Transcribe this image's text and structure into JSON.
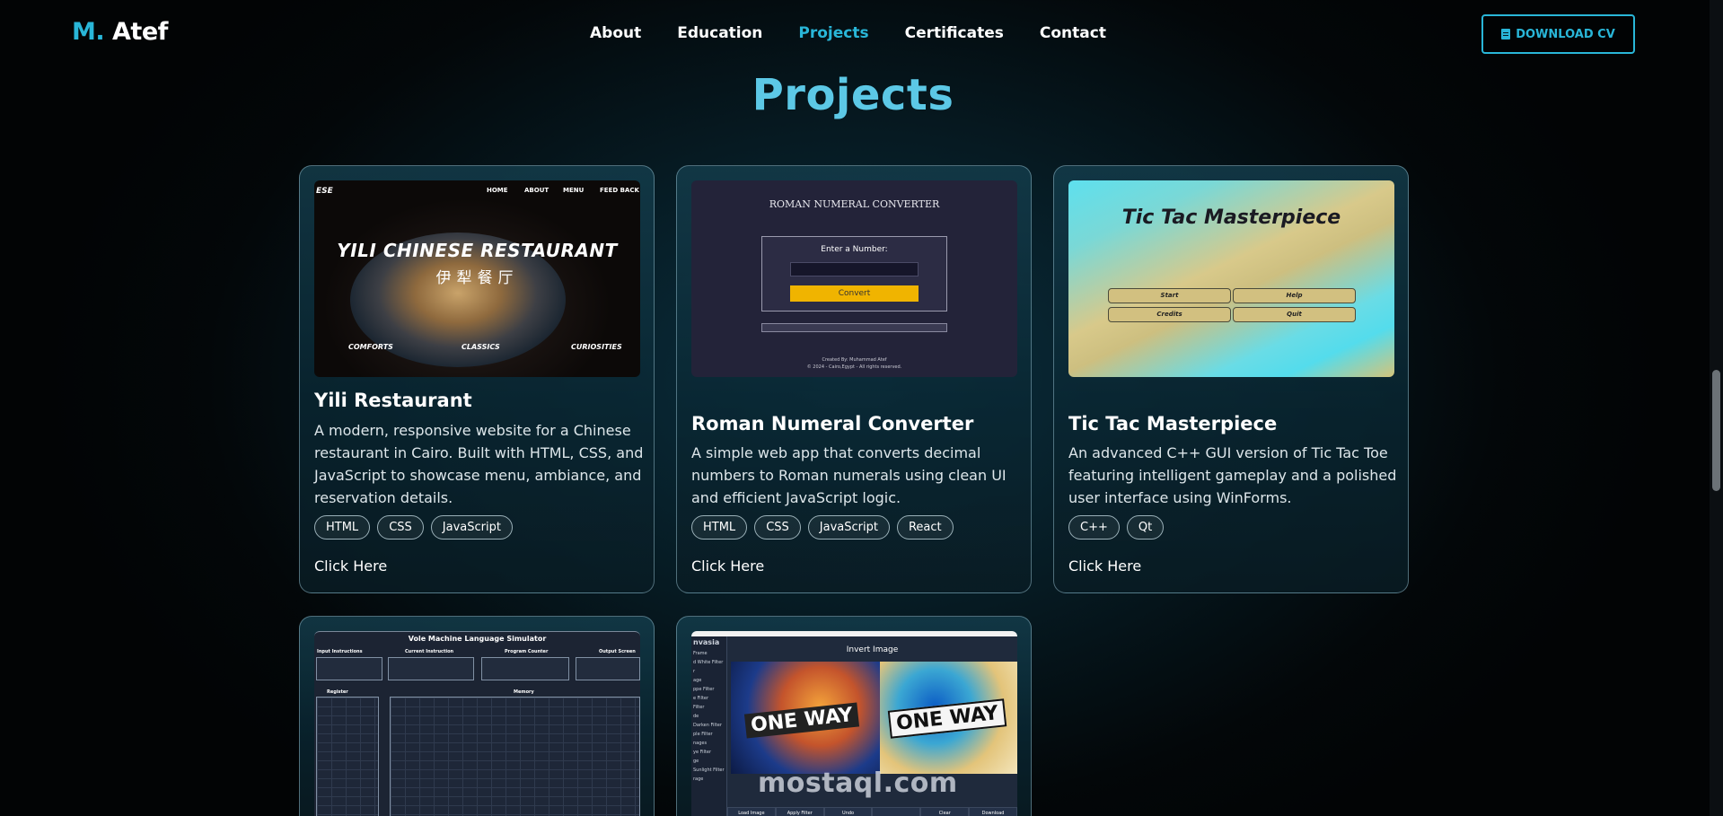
{
  "nav": {
    "logo_initial": "M.",
    "logo_name": "Atef",
    "links": [
      "About",
      "Education",
      "Projects",
      "Certificates",
      "Contact"
    ],
    "active": "Projects",
    "cv_button": "DOWNLOAD CV"
  },
  "section_title": "Projects",
  "projects": [
    {
      "title": "Yili Restaurant",
      "description": "A modern, responsive website for a Chinese restaurant in Cairo. Built with HTML, CSS, and JavaScript to showcase menu, ambiance, and reservation details.",
      "tags": [
        "HTML",
        "CSS",
        "JavaScript"
      ],
      "link": "Click Here",
      "preview": {
        "logo": "ESE",
        "menu": [
          "HOME",
          "ABOUT",
          "MENU",
          "FEED BACK"
        ],
        "headline": "YILI CHINESE RESTAURANT",
        "subtitle": "伊犁餐厅",
        "footer": [
          "COMFORTS",
          "CLASSICS",
          "CURIOSITIES"
        ]
      }
    },
    {
      "title": "Roman Numeral Converter",
      "description": "A simple web app that converts decimal numbers to Roman numerals using clean UI and efficient JavaScript logic.",
      "tags": [
        "HTML",
        "CSS",
        "JavaScript",
        "React"
      ],
      "link": "Click Here",
      "preview": {
        "heading": "ROMAN NUMERAL CONVERTER",
        "label": "Enter a Number:",
        "button": "Convert",
        "credit1": "Created By: Muhammad Atef",
        "credit2": "© 2024 - Cairo,Egypt - All rights reserved."
      }
    },
    {
      "title": "Tic Tac Masterpiece",
      "description": "An advanced C++ GUI version of Tic Tac Toe featuring intelligent gameplay and a polished user interface using WinForms.",
      "tags": [
        "C++",
        "Qt"
      ],
      "link": "Click Here",
      "preview": {
        "heading": "Tic Tac Masterpiece",
        "buttons": [
          "Start",
          "Help",
          "Credits",
          "Quit"
        ]
      }
    },
    {
      "preview": {
        "heading": "Vole Machine Language Simulator",
        "sections": [
          "Input Instructions",
          "Current Instruction",
          "Program Counter",
          "Output Screen"
        ],
        "register_label": "Register",
        "memory_label": "Memory"
      }
    },
    {
      "preview": {
        "app_name": "nvasia",
        "heading": "Invert Image",
        "menu": [
          "Frame",
          "d White Filter",
          "r",
          "age",
          "ppe Filter",
          "",
          "e Filter",
          "Filter",
          "de",
          "Darken Filter",
          "ple Filter",
          "nages",
          "ye Filter",
          "ge",
          "Sunlight Filter",
          "rage"
        ],
        "sign_text": "ONE WAY",
        "watermark": "mostaql.com",
        "buttons": [
          "Load Image",
          "Apply Filter",
          "Undo",
          "",
          "Clear",
          "Download"
        ]
      }
    }
  ]
}
